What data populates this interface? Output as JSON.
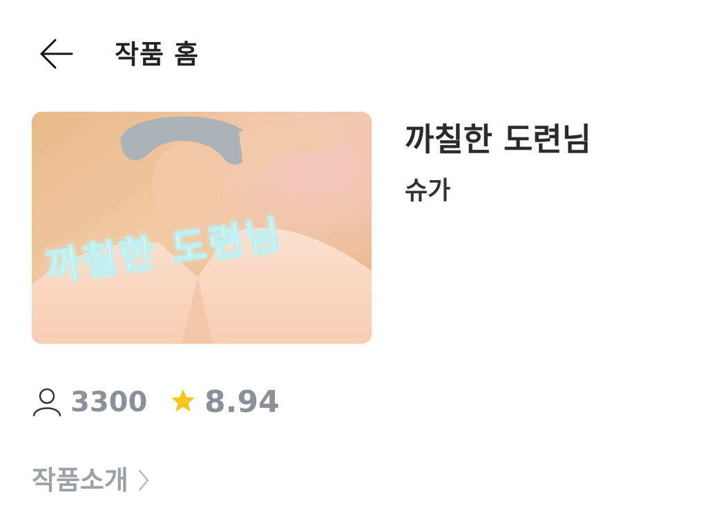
{
  "header": {
    "back_icon": "arrow-left-icon",
    "title": "작품 홈"
  },
  "work": {
    "cover_text": "까칠한 도련님",
    "title": "까칠한 도련님",
    "author": "슈가"
  },
  "stats": {
    "views_icon": "person-icon",
    "views": "3300",
    "rating_icon": "star-icon",
    "rating": "8.94"
  },
  "intro": {
    "label": "작품소개",
    "icon": "chevron-right-icon"
  },
  "colors": {
    "title_text": "#222222",
    "stat_text": "#8a9198",
    "intro_text": "#9aa0a6",
    "star": "#f7c51e",
    "cover_text_fill": "#ffffff",
    "cover_text_glow": "#bfeff0"
  }
}
